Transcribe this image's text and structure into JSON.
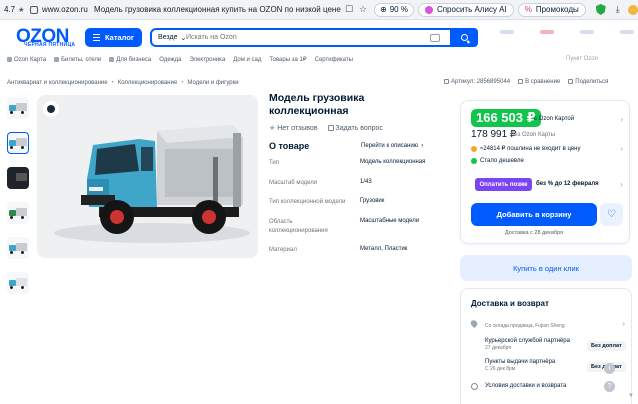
{
  "browser": {
    "rating": "4.7",
    "url": "www.ozon.ru",
    "tab_title": "Модель грузовика коллекционная купить на OZON по низкой цене (...",
    "zoom": "90 %",
    "alice_label": "Спросить Алису AI",
    "promo_label": "Промокоды"
  },
  "header": {
    "logo": "OZON",
    "logo_sub": "ЧЁРНАЯ ПЯТНИЦА",
    "catalog_label": "Каталог",
    "search_scope": "Везде",
    "search_placeholder": "Искать на Ozon"
  },
  "subnav": {
    "items": [
      "Ozon Карта",
      "Билеты, отели",
      "Для бизнеса",
      "Одежда",
      "Электроника",
      "Дом и сад",
      "Товары за 1₽",
      "Сертификаты"
    ],
    "pickup": "Пункт Ozon"
  },
  "breadcrumbs": [
    "Антиквариат и коллекционирование",
    "Коллекционирование",
    "Модели и фигурки"
  ],
  "meta": {
    "article": "Артикул: 2856895044",
    "compare": "В сравнение",
    "share": "Поделиться"
  },
  "product": {
    "title": "Модель грузовика коллекционная",
    "reviews": "Нет отзывов",
    "ask": "Задать вопрос",
    "about_heading": "О товаре",
    "about_link": "Перейти к описанию",
    "specs": [
      {
        "key": "Тип",
        "value": "Модель коллекционная"
      },
      {
        "key": "Масштаб модели",
        "value": "1/43"
      },
      {
        "key": "Тип коллекционной модели",
        "value": "Грузовик"
      },
      {
        "key": "Область коллекционирования",
        "value": "Масштабные модели"
      },
      {
        "key": "Материал",
        "value": "Металл, Пластик"
      }
    ]
  },
  "price": {
    "card_price": "166 503 ₽",
    "card_label": "c Ozon Картой",
    "regular_price": "178 991 ₽",
    "regular_label": "без Ozon Карты",
    "coins_line": "≈24814 ₽ пошлина не входит в цену",
    "cheaper": "Стало дешевле",
    "later_button": "Оплатить позже",
    "later_text": "без % до 12 февраля",
    "cart_button": "Добавить в корзину",
    "delivery_date": "Доставка с 28 декабря",
    "one_click": "Купить в один клик"
  },
  "delivery": {
    "heading": "Доставка и возврат",
    "from": "Со склада продавца, Fujian Sheng",
    "courier": "Курьерской службой партнёра",
    "courier_date": "27 декабря",
    "courier_badge": "Без доплат",
    "pickup_points": "Пункты выдачи партнёра",
    "pickup_date": "С 26 дек 8рм",
    "pickup_badge": "Без доплат",
    "terms": "Условия доставки и возврата"
  },
  "colors": {
    "brand": "#005bff",
    "price_green": "#10c44c",
    "later_purple": "#7b45f2"
  }
}
